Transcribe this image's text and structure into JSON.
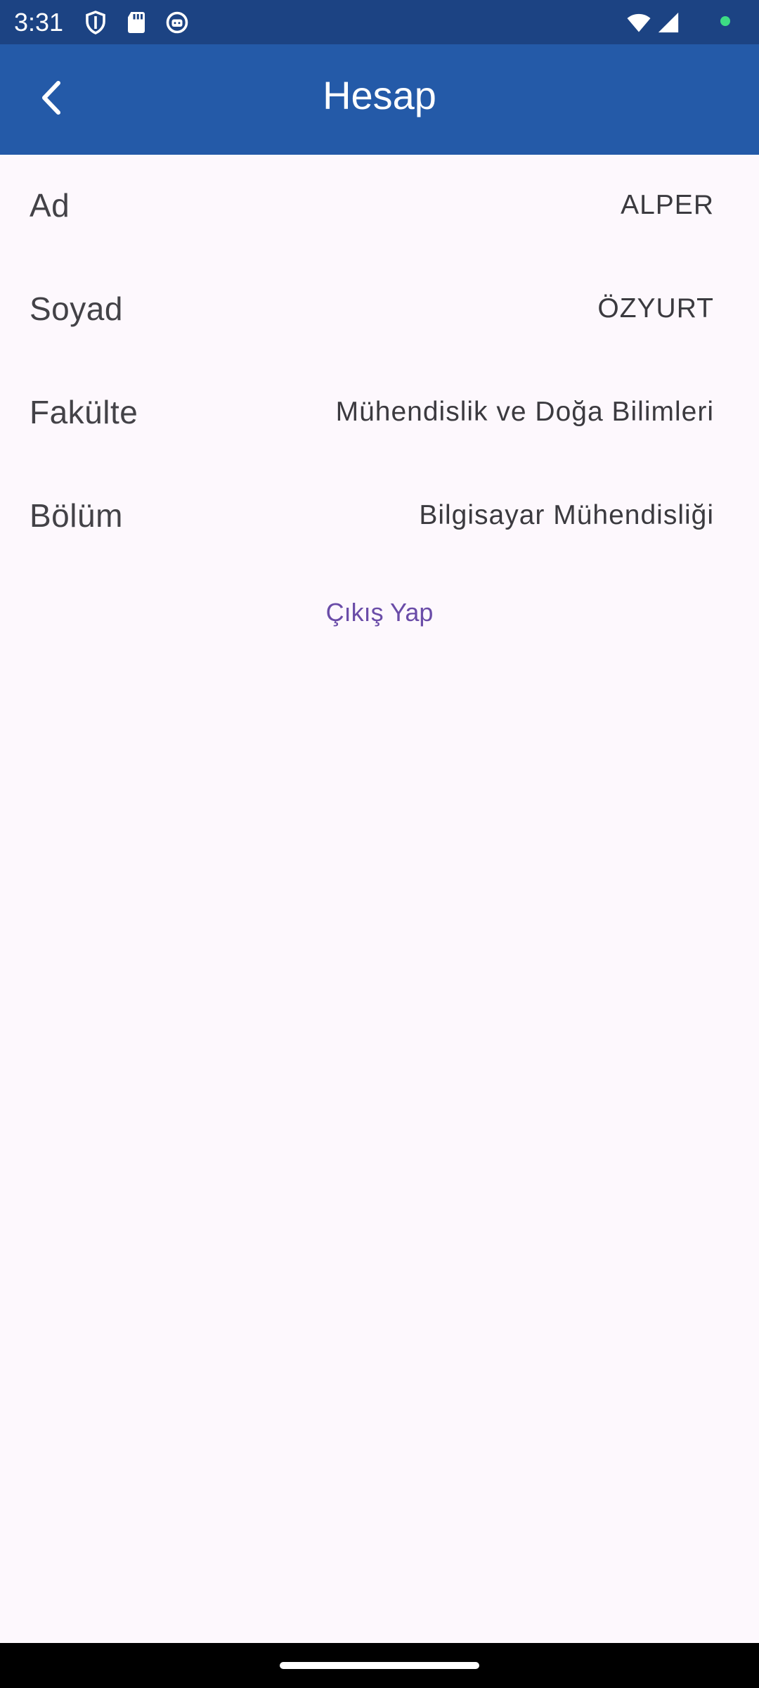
{
  "status_bar": {
    "time": "3:31",
    "left_icons": [
      "shield-icon",
      "sd-card-icon",
      "assistant-icon"
    ],
    "right_icons": [
      "wifi-icon",
      "signal-icon",
      "notification-dot-icon"
    ],
    "bg_color": "#1c4383"
  },
  "app_bar": {
    "title": "Hesap",
    "back_icon": "chevron-left-icon",
    "bg_color": "#245aa8"
  },
  "account": {
    "rows": [
      {
        "label": "Ad",
        "value": "ALPER"
      },
      {
        "label": "Soyad",
        "value": "ÖZYURT"
      },
      {
        "label": "Fakülte",
        "value": "Mühendislik ve Doğa Bilimleri"
      },
      {
        "label": "Bölüm",
        "value": "Bilgisayar Mühendisliği"
      }
    ]
  },
  "logout": {
    "label": "Çıkış Yap",
    "color": "#6a4ca8"
  }
}
